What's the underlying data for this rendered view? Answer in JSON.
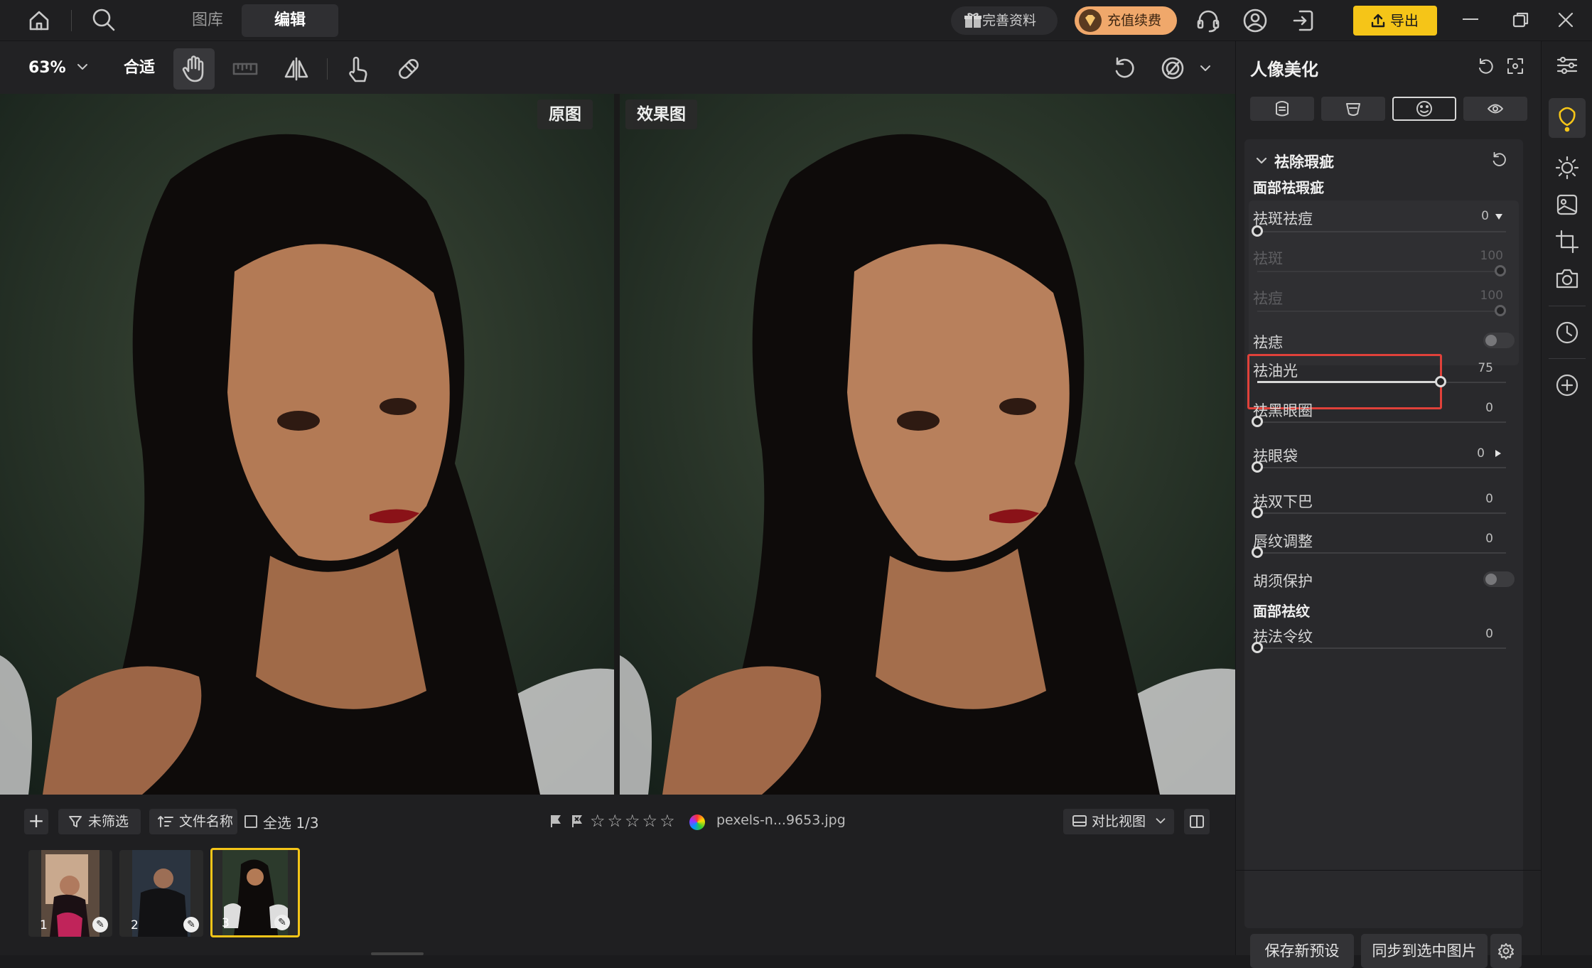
{
  "topbar": {
    "tabs": [
      "图库",
      "编辑"
    ],
    "profile_label": "完善资料",
    "vip_label": "充值续费",
    "export_label": "导出"
  },
  "toolbar": {
    "zoom": "63%",
    "fit_label": "合适"
  },
  "canvas": {
    "original_label": "原图",
    "effect_label": "效果图"
  },
  "bottom": {
    "filter_label": "未筛选",
    "sort_label": "文件名称",
    "select_all_label": "全选 1/3",
    "filename": "pexels-n...9653.jpg",
    "compare_view_label": "对比视图",
    "thumbnails": [
      "1",
      "2",
      "3"
    ],
    "selected_thumb": 3
  },
  "panel": {
    "title": "人像美化",
    "section_title": "祛除瑕疵",
    "subsection_face": "面部祛瑕疵",
    "subsection_wrinkle": "面部祛纹",
    "sliders": {
      "spots_acne": {
        "label": "祛斑祛痘",
        "value": "0"
      },
      "spots": {
        "label": "祛斑",
        "value": "100"
      },
      "acne": {
        "label": "祛痘",
        "value": "100"
      },
      "mole": {
        "label": "祛痣"
      },
      "oil": {
        "label": "祛油光",
        "value": "75"
      },
      "dark_circles": {
        "label": "祛黑眼圈",
        "value": "0"
      },
      "eye_bags": {
        "label": "祛眼袋",
        "value": "0"
      },
      "double_chin": {
        "label": "祛双下巴",
        "value": "0"
      },
      "lip_lines": {
        "label": "唇纹调整",
        "value": "0"
      },
      "beard": {
        "label": "胡须保护"
      },
      "nasolabial": {
        "label": "祛法令纹",
        "value": "0"
      }
    },
    "save_preset_label": "保存新预设",
    "sync_label": "同步到选中图片"
  },
  "colors": {
    "accent_yellow": "#f5c518",
    "highlight_red": "#e0413a",
    "vip_orange": "#f0a86b"
  }
}
